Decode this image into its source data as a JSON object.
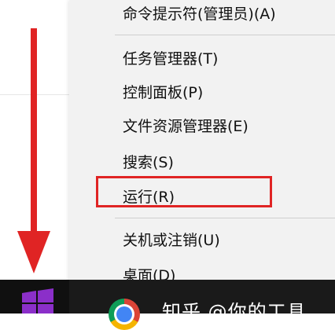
{
  "context_menu": {
    "items": [
      {
        "label": "命令提示符(管理员)(A)"
      },
      {
        "label": "任务管理器(T)"
      },
      {
        "label": "控制面板(P)"
      },
      {
        "label": "文件资源管理器(E)"
      },
      {
        "label": "搜索(S)"
      },
      {
        "label": "运行(R)"
      },
      {
        "label": "关机或注销(U)"
      },
      {
        "label": "桌面(D)"
      }
    ]
  },
  "taskbar": {
    "icons": [
      "windows-logo-icon",
      "chrome-icon"
    ],
    "watermark_text": "知乎 @你的工具"
  },
  "colors": {
    "annotation_red": "#e02424",
    "menu_background": "#f2f2f2",
    "taskbar_background": "#1a1a1a",
    "windows_logo_purple": "#8b2fc9"
  }
}
